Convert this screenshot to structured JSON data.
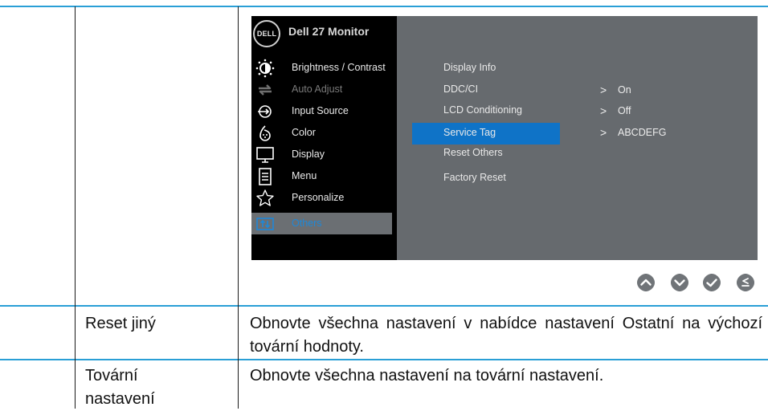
{
  "osd": {
    "logo_text": "DELL",
    "title": "Dell 27 Monitor",
    "menu": [
      {
        "label": "Brightness / Contrast",
        "icon": "brightness-icon"
      },
      {
        "label": "Auto Adjust",
        "icon": "auto-adjust-icon"
      },
      {
        "label": "Input Source",
        "icon": "input-source-icon"
      },
      {
        "label": "Color",
        "icon": "color-icon"
      },
      {
        "label": "Display",
        "icon": "display-icon"
      },
      {
        "label": "Menu",
        "icon": "menu-icon"
      },
      {
        "label": "Personalize",
        "icon": "star-icon"
      },
      {
        "label": "Others",
        "icon": "others-icon"
      }
    ],
    "selected_menu": "Others",
    "submenu": [
      "Display Info",
      "DDC/CI",
      "LCD Conditioning",
      "Service Tag",
      "Reset Others",
      "Factory Reset"
    ],
    "selected_submenu": "Service Tag",
    "values": {
      "ddc_ci": "On",
      "lcd_conditioning": "Off",
      "service_tag": "ABCDEFG"
    },
    "arrow_glyph": ">",
    "buttons": [
      "up-icon",
      "down-icon",
      "check-icon",
      "back-icon"
    ]
  },
  "rows": [
    {
      "name": "Reset jiný",
      "description": "Obnovte všechna nastavení v nabídce nastavení Ostatní na výchozí tovární hodnoty."
    },
    {
      "name": "Tovární nastavení",
      "description": "Obnovte všechna nastavení na tovární nastavení."
    }
  ],
  "colors": {
    "table_line": "#2a9fd6",
    "osd_bg": "#000000",
    "osd_panel": "#666a6e",
    "highlight": "#0f73c7",
    "button": "#707478"
  }
}
